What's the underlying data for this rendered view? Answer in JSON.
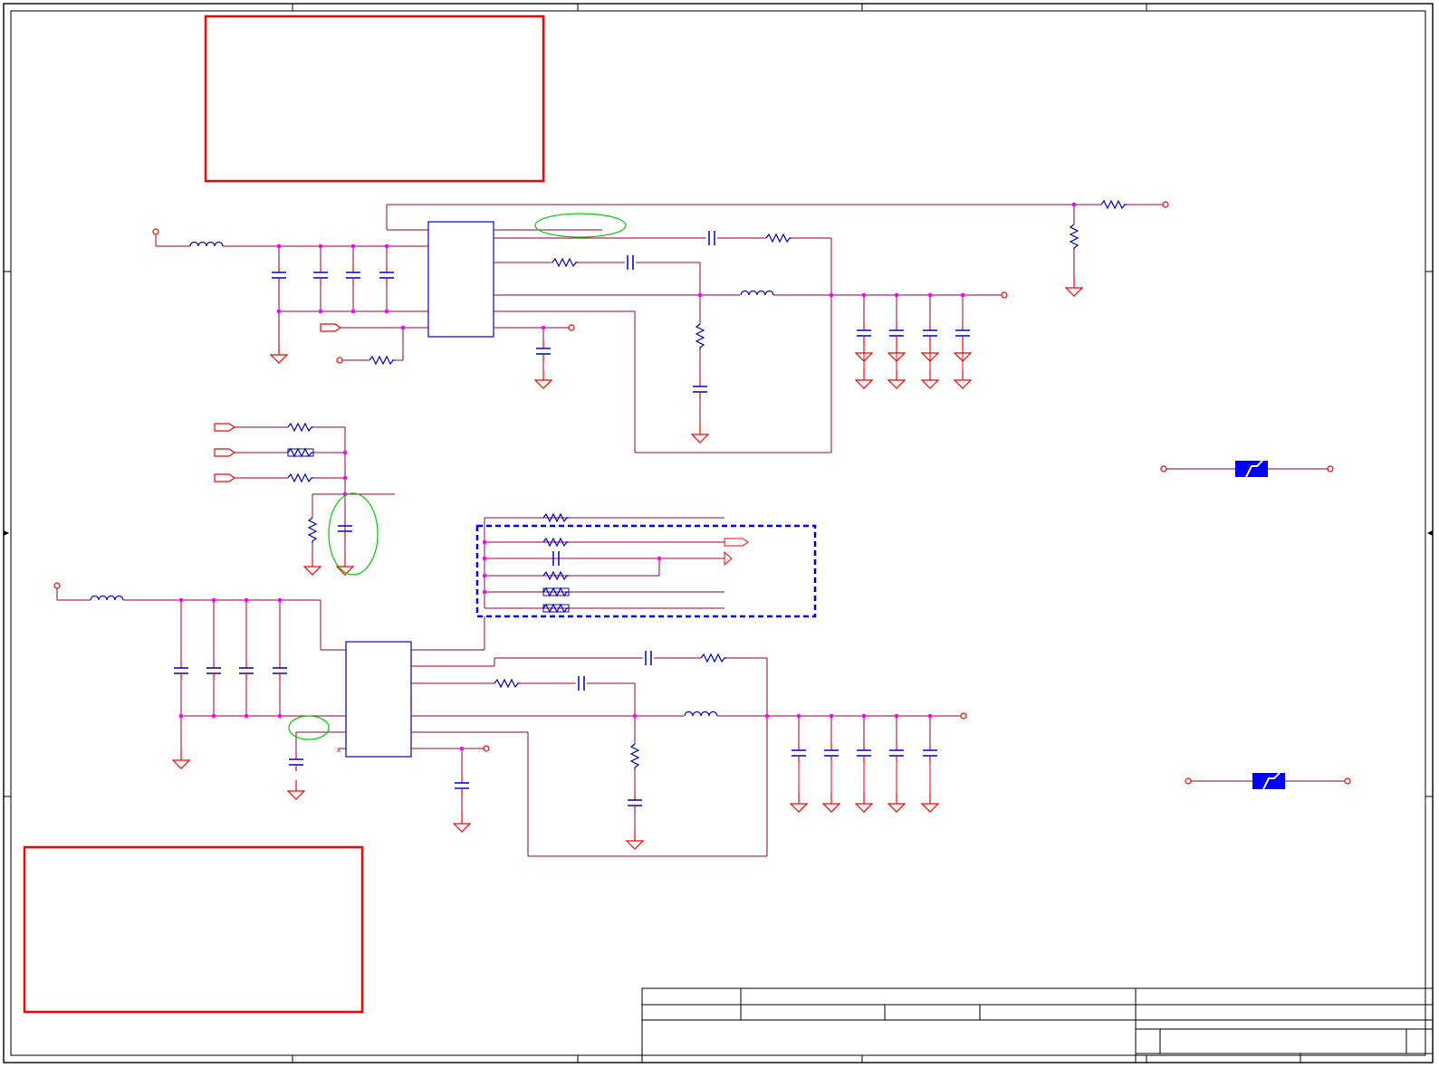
{
  "sheet": {
    "title": "",
    "title_block": {
      "cells": [
        "",
        "",
        "",
        "",
        "",
        "",
        "",
        ""
      ]
    }
  },
  "colors": {
    "wire": "#990033",
    "red_wire": "#ff0000",
    "component": "#0000cc",
    "junction": "#ff00ff",
    "highlight_box": "#ff0000",
    "highlight_ellipse": "#00cc00",
    "dashed_group": "#0000ff",
    "ground": "#ff0000",
    "fuse_fill": "#0000ff"
  },
  "annotations": {
    "note_top": "",
    "note_bottom": ""
  }
}
